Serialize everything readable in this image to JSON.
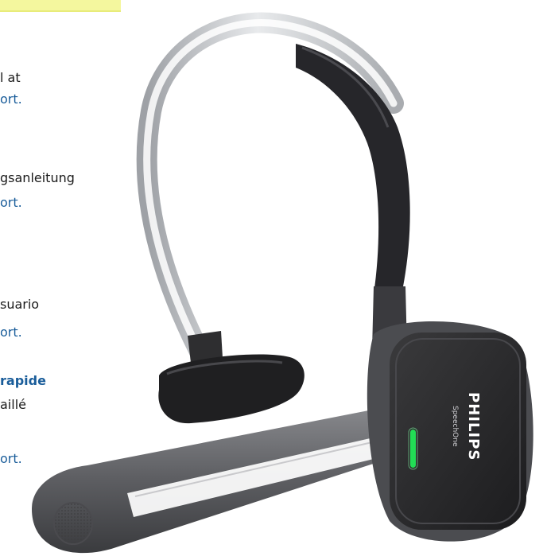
{
  "text_fragments": [
    {
      "id": "l1",
      "text": "l at"
    },
    {
      "id": "l2",
      "text": "ort.",
      "style": "link"
    },
    {
      "id": "l3",
      "text": "gsanleitung"
    },
    {
      "id": "l4",
      "text": "ort.",
      "style": "link"
    },
    {
      "id": "l5",
      "text": "suario"
    },
    {
      "id": "l6",
      "text": "ort.",
      "style": "link"
    },
    {
      "id": "l7",
      "text": "rapide",
      "style": "strong-link"
    },
    {
      "id": "l8",
      "text": "aillé"
    },
    {
      "id": "l9",
      "text": "ort.",
      "style": "link"
    }
  ],
  "product": {
    "brand": "PHILIPS",
    "model": "SpeechOne",
    "led_color": "#22dd55",
    "body_color": "#2b2b2d",
    "boom_color": "#6e6e72",
    "band_color": "#c9cbce"
  },
  "colors": {
    "link": "#1a5d9a",
    "text": "#1a1a1a",
    "highlight": "#f4f79e"
  }
}
